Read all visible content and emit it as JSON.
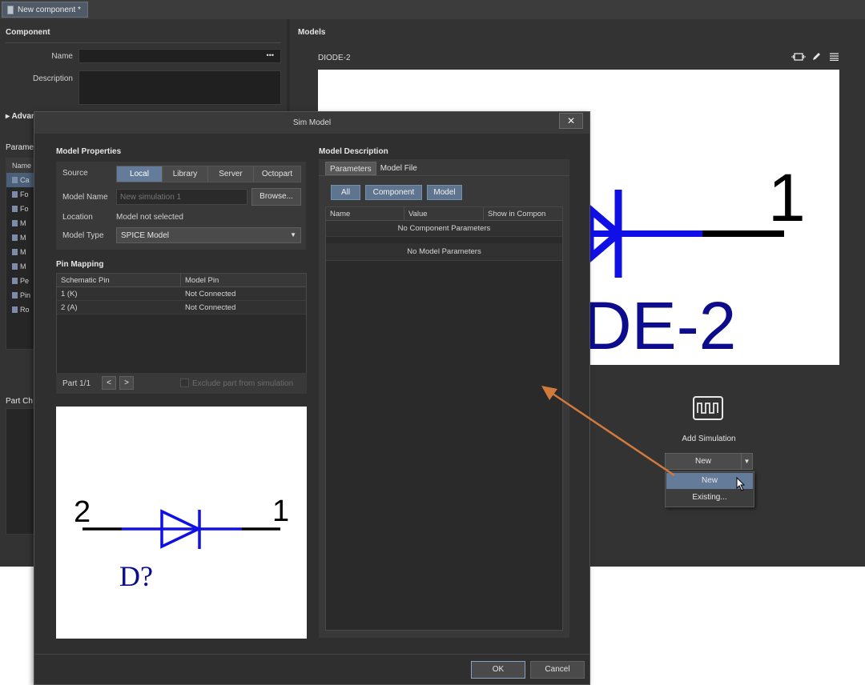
{
  "document_tab": {
    "title": "New component *"
  },
  "component_panel": {
    "title": "Component",
    "name_label": "Name",
    "name_value": "",
    "name_menu": "•••",
    "description_label": "Description",
    "advanced_label": "Advan",
    "parameters_title": "Parame",
    "param_col_name": "Name",
    "param_rows": [
      "Ca",
      "Fo",
      "Fo",
      "M",
      "M",
      "M",
      "M",
      "Pe",
      "Pin",
      "Ro"
    ],
    "part_choices_title": "Part Ch"
  },
  "models_panel": {
    "title": "Models",
    "model_name": "DIODE-2",
    "preview_pin_label": "1",
    "preview_text": "DE-2",
    "icons": [
      "fit-view-icon",
      "edit-pencil-icon",
      "hamburger-menu-icon"
    ],
    "add_simulation_label": "Add Simulation",
    "new_button": "New",
    "dropdown_items": [
      "New",
      "Existing..."
    ]
  },
  "dialog": {
    "title": "Sim Model",
    "close": "✕",
    "model_properties": {
      "title": "Model Properties",
      "source_label": "Source",
      "source_options": [
        "Local",
        "Library",
        "Server",
        "Octopart"
      ],
      "source_selected": "Local",
      "model_name_label": "Model Name",
      "model_name_placeholder": "New simulation 1",
      "browse_button": "Browse...",
      "location_label": "Location",
      "location_value": "Model not selected",
      "model_type_label": "Model Type",
      "model_type_value": "SPICE Model"
    },
    "pin_mapping": {
      "title": "Pin Mapping",
      "columns": [
        "Schematic Pin",
        "Model Pin"
      ],
      "rows": [
        {
          "schematic_pin": "1 (K)",
          "model_pin": "Not Connected"
        },
        {
          "schematic_pin": "2 (A)",
          "model_pin": "Not Connected"
        }
      ],
      "part_label": "Part 1/1",
      "prev": "<",
      "next": ">",
      "exclude_label": "Exclude part from simulation"
    },
    "symbol_preview": {
      "pin_left": "2",
      "pin_right": "1",
      "designator": "D?"
    },
    "model_description": {
      "title": "Model Description",
      "tabs": [
        "Parameters",
        "Model File"
      ],
      "filters": [
        "All",
        "Component",
        "Model"
      ],
      "columns": [
        "Name",
        "Value",
        "Show in Compon"
      ],
      "no_component_params": "No Component Parameters",
      "no_model_params": "No Model Parameters"
    },
    "ok_button": "OK",
    "cancel_button": "Cancel"
  },
  "colors": {
    "accent": "#647c99",
    "annotation_arrow": "#d07a3c",
    "diode_blue": "#1010e6",
    "text_navy": "#0c0c8c"
  }
}
